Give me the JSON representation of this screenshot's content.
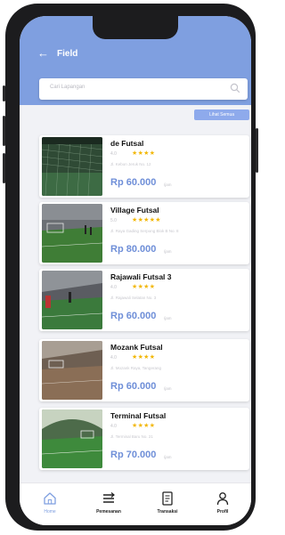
{
  "header": {
    "title": "Field"
  },
  "search": {
    "placeholder": "Cari Lapangan"
  },
  "map_button": {
    "label": "Lihat Semua"
  },
  "fields": [
    {
      "name": "de Futsal",
      "rating": "4.0",
      "stars": "★★★★",
      "address": "Jl. Kebon Jeruk No. 12",
      "price": "Rp 60.000",
      "unit": "/jam"
    },
    {
      "name": "Village Futsal",
      "rating": "5.0",
      "stars": "★★★★★",
      "address": "Jl. Raya Gading Serpong Blok B No. 8",
      "price": "Rp 80.000",
      "unit": "/jam"
    },
    {
      "name": "Rajawali Futsal 3",
      "rating": "4.0",
      "stars": "★★★★",
      "address": "Jl. Rajawali Selatan No. 3",
      "price": "Rp 60.000",
      "unit": "/jam"
    },
    {
      "name": "Mozank Futsal",
      "rating": "4.0",
      "stars": "★★★★",
      "address": "Jl. Mozank Raya, Tangerang",
      "price": "Rp 60.000",
      "unit": "/jam"
    },
    {
      "name": "Terminal Futsal",
      "rating": "4.0",
      "stars": "★★★★",
      "address": "Jl. Terminal Baru No. 21",
      "price": "Rp 70.000",
      "unit": "/jam"
    }
  ],
  "nav": [
    {
      "label": "Home",
      "icon": "home-icon",
      "active": true
    },
    {
      "label": "Pemesanan",
      "icon": "list-icon",
      "active": false
    },
    {
      "label": "Transaksi",
      "icon": "receipt-icon",
      "active": false
    },
    {
      "label": "Profil",
      "icon": "user-icon",
      "active": false
    }
  ],
  "colors": {
    "primary": "#7f9fe0",
    "price": "#6f8fd8",
    "star": "#f2b705",
    "background": "#f1f2f6"
  }
}
